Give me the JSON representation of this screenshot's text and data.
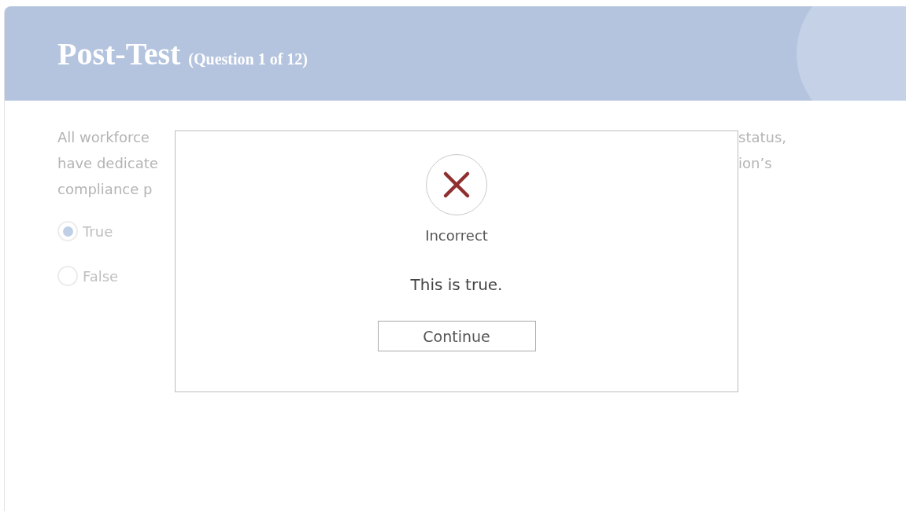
{
  "header": {
    "title": "Post-Test",
    "subtitle": "(Question 1 of 12)"
  },
  "question": {
    "left_fragments": [
      "All workforce",
      "have dedicate",
      "compliance p"
    ],
    "right_fragments": [
      "status,",
      "ion’s"
    ]
  },
  "options": [
    {
      "label": "True",
      "selected": true
    },
    {
      "label": "False",
      "selected": false
    }
  ],
  "feedback": {
    "kind": "incorrect",
    "result": "Incorrect",
    "message": "This is true.",
    "button": "Continue"
  }
}
